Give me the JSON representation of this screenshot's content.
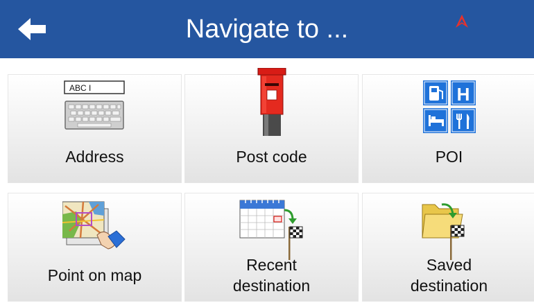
{
  "header": {
    "title": "Navigate to ...",
    "back_icon": "back-arrow-icon",
    "gps_icon": "gps-arrow-icon",
    "background_color": "#2556a0",
    "gps_color": "#e8312b"
  },
  "menu": {
    "address": {
      "label": "Address",
      "icon": "keyboard-icon",
      "field_text": "ABC I"
    },
    "post_code": {
      "label": "Post code",
      "icon": "postbox-icon"
    },
    "poi": {
      "label": "POI",
      "icon": "poi-icon",
      "letter": "H"
    },
    "point_on_map": {
      "label": "Point on map",
      "icon": "map-point-icon"
    },
    "recent_destination": {
      "label_line1": "Recent",
      "label_line2": "destination",
      "icon": "calendar-flag-icon"
    },
    "saved_destination": {
      "label_line1": "Saved",
      "label_line2": "destination",
      "icon": "folder-flag-icon"
    }
  }
}
